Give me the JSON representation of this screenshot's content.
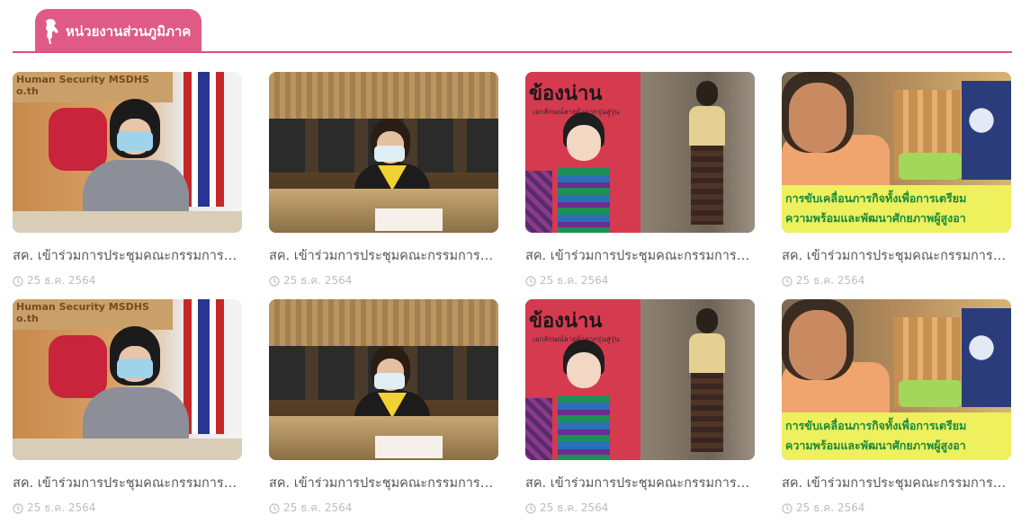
{
  "section": {
    "title": "หน่วยงานส่วนภูมิภาค",
    "icon": "thailand-map-icon",
    "accent_color": "#e05a86"
  },
  "image_texts": {
    "sign_text": "Human Security MSDHS\no.th",
    "poster_title": "ข้องน่าน",
    "poster_subtitle": "เอกลักษณ์ลายผ้าจากรุ่นสู่รุ่น",
    "banner_line1": "การขับเคลื่อนภารกิจทั้งเพื่อการเตรียม",
    "banner_line2": "ความพร้อมและพัฒนาศักยภาพผู้สูงอา"
  },
  "cards": [
    {
      "title": "สค. เข้าร่วมการประชุมคณะกรรมการด้านการส่งเสริมและพัฒนาสตรี",
      "date": "25 ธ.ค. 2564",
      "clock_icon": "clock-icon"
    },
    {
      "title": "สค. เข้าร่วมการประชุมคณะกรรมการด้านการส่งเสริมและพัฒนาสตรี",
      "date": "25 ธ.ค. 2564",
      "clock_icon": "clock-icon"
    },
    {
      "title": "สค. เข้าร่วมการประชุมคณะกรรมการด้านการส่งเสริมและพัฒนาสตรี",
      "date": "25 ธ.ค. 2564",
      "clock_icon": "clock-icon"
    },
    {
      "title": "สค. เข้าร่วมการประชุมคณะกรรมการด้านการส่งเสริมและพัฒนาสตรี",
      "date": "25 ธ.ค. 2564",
      "clock_icon": "clock-icon"
    },
    {
      "title": "สค. เข้าร่วมการประชุมคณะกรรมการด้านการส่งเสริมและพัฒนาสตรี",
      "date": "25 ธ.ค. 2564",
      "clock_icon": "clock-icon"
    },
    {
      "title": "สค. เข้าร่วมการประชุมคณะกรรมการด้านการส่งเสริมและพัฒนาสตรี",
      "date": "25 ธ.ค. 2564",
      "clock_icon": "clock-icon"
    },
    {
      "title": "สค. เข้าร่วมการประชุมคณะกรรมการด้านการส่งเสริมและพัฒนาสตรี",
      "date": "25 ธ.ค. 2564",
      "clock_icon": "clock-icon"
    },
    {
      "title": "สค. เข้าร่วมการประชุมคณะกรรมการด้านการส่งเสริมและพัฒนาสตรี",
      "date": "25 ธ.ค. 2564",
      "clock_icon": "clock-icon"
    }
  ]
}
